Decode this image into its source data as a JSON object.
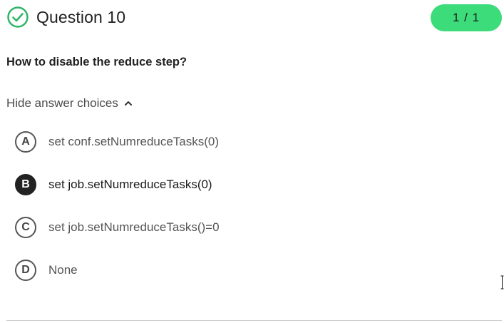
{
  "header": {
    "title": "Question 10",
    "score": "1 / 1",
    "status_icon": "check-circle-icon",
    "accent_color": "#3ddc7a",
    "check_color": "#2fb567"
  },
  "question": {
    "prompt": "How to disable the reduce step?"
  },
  "answer_toggle": {
    "label": "Hide answer choices",
    "icon": "chevron-up-icon"
  },
  "choices": [
    {
      "letter": "A",
      "text": "set conf.setNumreduceTasks(0)",
      "selected": false
    },
    {
      "letter": "B",
      "text": "set job.setNumreduceTasks(0)",
      "selected": true
    },
    {
      "letter": "C",
      "text": "set job.setNumreduceTasks()=0",
      "selected": false
    },
    {
      "letter": "D",
      "text": "None",
      "selected": false
    }
  ]
}
